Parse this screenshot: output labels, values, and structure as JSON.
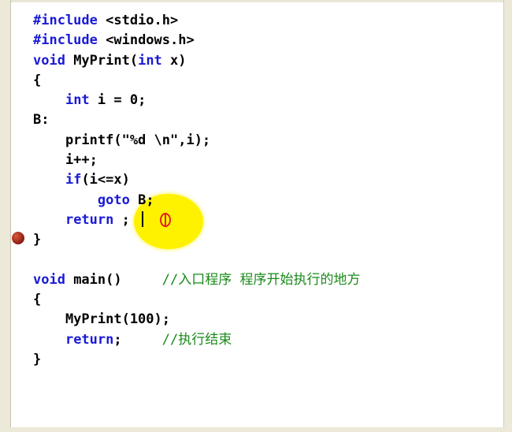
{
  "editor": {
    "lines": [
      {
        "parts": [
          {
            "t": "#include",
            "c": "kw"
          },
          {
            "t": " <stdio.h>",
            "c": ""
          }
        ]
      },
      {
        "parts": [
          {
            "t": "#include",
            "c": "kw"
          },
          {
            "t": " <windows.h>",
            "c": ""
          }
        ]
      },
      {
        "parts": [
          {
            "t": "void",
            "c": "kw"
          },
          {
            "t": " MyPrint(",
            "c": ""
          },
          {
            "t": "int",
            "c": "kw"
          },
          {
            "t": " x)",
            "c": ""
          }
        ]
      },
      {
        "parts": [
          {
            "t": "{",
            "c": ""
          }
        ]
      },
      {
        "parts": [
          {
            "t": "    ",
            "c": ""
          },
          {
            "t": "int",
            "c": "kw"
          },
          {
            "t": " i = 0;",
            "c": ""
          }
        ]
      },
      {
        "parts": [
          {
            "t": "B:",
            "c": ""
          }
        ]
      },
      {
        "parts": [
          {
            "t": "    printf(\"%d \\n\",i);",
            "c": ""
          }
        ]
      },
      {
        "parts": [
          {
            "t": "    i++;",
            "c": ""
          }
        ]
      },
      {
        "parts": [
          {
            "t": "    ",
            "c": ""
          },
          {
            "t": "if",
            "c": "kw"
          },
          {
            "t": "(i<=x)",
            "c": ""
          }
        ]
      },
      {
        "parts": [
          {
            "t": "        ",
            "c": ""
          },
          {
            "t": "goto",
            "c": "kw"
          },
          {
            "t": " B;",
            "c": ""
          }
        ]
      },
      {
        "parts": [
          {
            "t": "    ",
            "c": ""
          },
          {
            "t": "return",
            "c": "kw"
          },
          {
            "t": " ;",
            "c": ""
          }
        ]
      },
      {
        "parts": [
          {
            "t": "}",
            "c": ""
          }
        ]
      },
      {
        "parts": [
          {
            "t": "",
            "c": ""
          }
        ]
      },
      {
        "parts": [
          {
            "t": "void",
            "c": "kw"
          },
          {
            "t": " main()     ",
            "c": ""
          },
          {
            "t": "//入口程序 程序开始执行的地方",
            "c": "cm"
          }
        ]
      },
      {
        "parts": [
          {
            "t": "{",
            "c": ""
          }
        ]
      },
      {
        "parts": [
          {
            "t": "    MyPrint(100);",
            "c": ""
          }
        ]
      },
      {
        "parts": [
          {
            "t": "    ",
            "c": ""
          },
          {
            "t": "return",
            "c": "kw"
          },
          {
            "t": ";     ",
            "c": ""
          },
          {
            "t": "//执行结束",
            "c": "cm"
          }
        ]
      },
      {
        "parts": [
          {
            "t": "}",
            "c": ""
          }
        ]
      }
    ],
    "breakpoint_line": 12,
    "cursor_line": 11,
    "colors": {
      "keyword": "#1a1ad6",
      "comment": "#1a8a1a",
      "text": "#000000",
      "gutter": "#ECE9D8",
      "breakpoint": "#8a1a10",
      "highlight": "#fff200"
    }
  }
}
